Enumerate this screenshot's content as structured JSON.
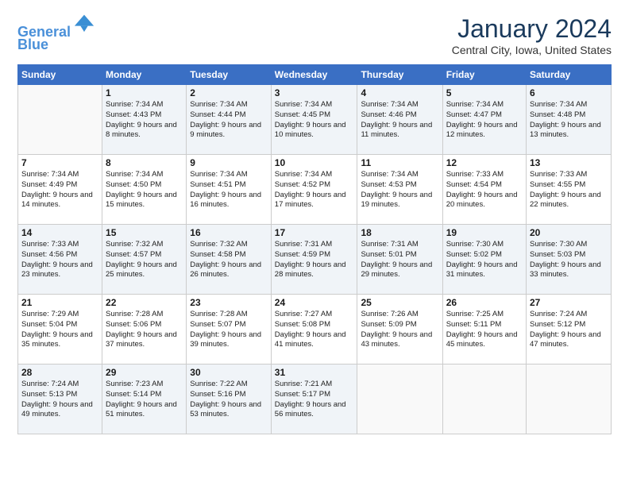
{
  "header": {
    "logo_line1": "General",
    "logo_line2": "Blue",
    "month_title": "January 2024",
    "location": "Central City, Iowa, United States"
  },
  "days_of_week": [
    "Sunday",
    "Monday",
    "Tuesday",
    "Wednesday",
    "Thursday",
    "Friday",
    "Saturday"
  ],
  "weeks": [
    [
      {
        "day": "",
        "sunrise": "",
        "sunset": "",
        "daylight": ""
      },
      {
        "day": "1",
        "sunrise": "Sunrise: 7:34 AM",
        "sunset": "Sunset: 4:43 PM",
        "daylight": "Daylight: 9 hours and 8 minutes."
      },
      {
        "day": "2",
        "sunrise": "Sunrise: 7:34 AM",
        "sunset": "Sunset: 4:44 PM",
        "daylight": "Daylight: 9 hours and 9 minutes."
      },
      {
        "day": "3",
        "sunrise": "Sunrise: 7:34 AM",
        "sunset": "Sunset: 4:45 PM",
        "daylight": "Daylight: 9 hours and 10 minutes."
      },
      {
        "day": "4",
        "sunrise": "Sunrise: 7:34 AM",
        "sunset": "Sunset: 4:46 PM",
        "daylight": "Daylight: 9 hours and 11 minutes."
      },
      {
        "day": "5",
        "sunrise": "Sunrise: 7:34 AM",
        "sunset": "Sunset: 4:47 PM",
        "daylight": "Daylight: 9 hours and 12 minutes."
      },
      {
        "day": "6",
        "sunrise": "Sunrise: 7:34 AM",
        "sunset": "Sunset: 4:48 PM",
        "daylight": "Daylight: 9 hours and 13 minutes."
      }
    ],
    [
      {
        "day": "7",
        "sunrise": "Sunrise: 7:34 AM",
        "sunset": "Sunset: 4:49 PM",
        "daylight": "Daylight: 9 hours and 14 minutes."
      },
      {
        "day": "8",
        "sunrise": "Sunrise: 7:34 AM",
        "sunset": "Sunset: 4:50 PM",
        "daylight": "Daylight: 9 hours and 15 minutes."
      },
      {
        "day": "9",
        "sunrise": "Sunrise: 7:34 AM",
        "sunset": "Sunset: 4:51 PM",
        "daylight": "Daylight: 9 hours and 16 minutes."
      },
      {
        "day": "10",
        "sunrise": "Sunrise: 7:34 AM",
        "sunset": "Sunset: 4:52 PM",
        "daylight": "Daylight: 9 hours and 17 minutes."
      },
      {
        "day": "11",
        "sunrise": "Sunrise: 7:34 AM",
        "sunset": "Sunset: 4:53 PM",
        "daylight": "Daylight: 9 hours and 19 minutes."
      },
      {
        "day": "12",
        "sunrise": "Sunrise: 7:33 AM",
        "sunset": "Sunset: 4:54 PM",
        "daylight": "Daylight: 9 hours and 20 minutes."
      },
      {
        "day": "13",
        "sunrise": "Sunrise: 7:33 AM",
        "sunset": "Sunset: 4:55 PM",
        "daylight": "Daylight: 9 hours and 22 minutes."
      }
    ],
    [
      {
        "day": "14",
        "sunrise": "Sunrise: 7:33 AM",
        "sunset": "Sunset: 4:56 PM",
        "daylight": "Daylight: 9 hours and 23 minutes."
      },
      {
        "day": "15",
        "sunrise": "Sunrise: 7:32 AM",
        "sunset": "Sunset: 4:57 PM",
        "daylight": "Daylight: 9 hours and 25 minutes."
      },
      {
        "day": "16",
        "sunrise": "Sunrise: 7:32 AM",
        "sunset": "Sunset: 4:58 PM",
        "daylight": "Daylight: 9 hours and 26 minutes."
      },
      {
        "day": "17",
        "sunrise": "Sunrise: 7:31 AM",
        "sunset": "Sunset: 4:59 PM",
        "daylight": "Daylight: 9 hours and 28 minutes."
      },
      {
        "day": "18",
        "sunrise": "Sunrise: 7:31 AM",
        "sunset": "Sunset: 5:01 PM",
        "daylight": "Daylight: 9 hours and 29 minutes."
      },
      {
        "day": "19",
        "sunrise": "Sunrise: 7:30 AM",
        "sunset": "Sunset: 5:02 PM",
        "daylight": "Daylight: 9 hours and 31 minutes."
      },
      {
        "day": "20",
        "sunrise": "Sunrise: 7:30 AM",
        "sunset": "Sunset: 5:03 PM",
        "daylight": "Daylight: 9 hours and 33 minutes."
      }
    ],
    [
      {
        "day": "21",
        "sunrise": "Sunrise: 7:29 AM",
        "sunset": "Sunset: 5:04 PM",
        "daylight": "Daylight: 9 hours and 35 minutes."
      },
      {
        "day": "22",
        "sunrise": "Sunrise: 7:28 AM",
        "sunset": "Sunset: 5:06 PM",
        "daylight": "Daylight: 9 hours and 37 minutes."
      },
      {
        "day": "23",
        "sunrise": "Sunrise: 7:28 AM",
        "sunset": "Sunset: 5:07 PM",
        "daylight": "Daylight: 9 hours and 39 minutes."
      },
      {
        "day": "24",
        "sunrise": "Sunrise: 7:27 AM",
        "sunset": "Sunset: 5:08 PM",
        "daylight": "Daylight: 9 hours and 41 minutes."
      },
      {
        "day": "25",
        "sunrise": "Sunrise: 7:26 AM",
        "sunset": "Sunset: 5:09 PM",
        "daylight": "Daylight: 9 hours and 43 minutes."
      },
      {
        "day": "26",
        "sunrise": "Sunrise: 7:25 AM",
        "sunset": "Sunset: 5:11 PM",
        "daylight": "Daylight: 9 hours and 45 minutes."
      },
      {
        "day": "27",
        "sunrise": "Sunrise: 7:24 AM",
        "sunset": "Sunset: 5:12 PM",
        "daylight": "Daylight: 9 hours and 47 minutes."
      }
    ],
    [
      {
        "day": "28",
        "sunrise": "Sunrise: 7:24 AM",
        "sunset": "Sunset: 5:13 PM",
        "daylight": "Daylight: 9 hours and 49 minutes."
      },
      {
        "day": "29",
        "sunrise": "Sunrise: 7:23 AM",
        "sunset": "Sunset: 5:14 PM",
        "daylight": "Daylight: 9 hours and 51 minutes."
      },
      {
        "day": "30",
        "sunrise": "Sunrise: 7:22 AM",
        "sunset": "Sunset: 5:16 PM",
        "daylight": "Daylight: 9 hours and 53 minutes."
      },
      {
        "day": "31",
        "sunrise": "Sunrise: 7:21 AM",
        "sunset": "Sunset: 5:17 PM",
        "daylight": "Daylight: 9 hours and 56 minutes."
      },
      {
        "day": "",
        "sunrise": "",
        "sunset": "",
        "daylight": ""
      },
      {
        "day": "",
        "sunrise": "",
        "sunset": "",
        "daylight": ""
      },
      {
        "day": "",
        "sunrise": "",
        "sunset": "",
        "daylight": ""
      }
    ]
  ]
}
